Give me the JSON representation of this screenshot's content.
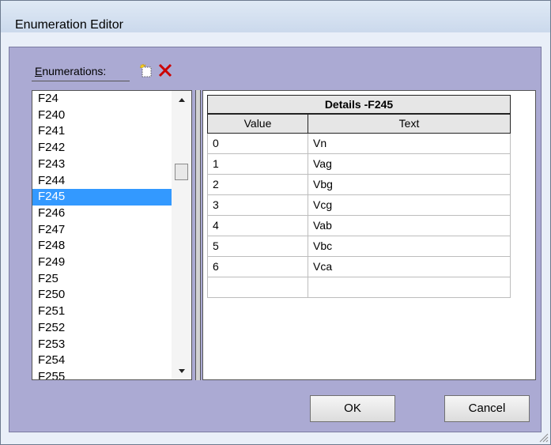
{
  "window": {
    "title": "Enumeration Editor"
  },
  "toolbar": {
    "enumerations_label_mnemonic": "E",
    "enumerations_label_rest": "numerations:",
    "new_icon": "new-document-icon",
    "delete_icon": "red-x-icon"
  },
  "enum_list": {
    "items": [
      "F24",
      "F240",
      "F241",
      "F242",
      "F243",
      "F244",
      "F245",
      "F246",
      "F247",
      "F248",
      "F249",
      "F25",
      "F250",
      "F251",
      "F252",
      "F253",
      "F254",
      "F255"
    ],
    "selected": "F245"
  },
  "details": {
    "title": "Details -F245",
    "columns": [
      "Value",
      "Text"
    ],
    "rows": [
      {
        "value": "0",
        "text": "Vn"
      },
      {
        "value": "1",
        "text": "Vag"
      },
      {
        "value": "2",
        "text": "Vbg"
      },
      {
        "value": "3",
        "text": "Vcg"
      },
      {
        "value": "4",
        "text": "Vab"
      },
      {
        "value": "5",
        "text": "Vbc"
      },
      {
        "value": "6",
        "text": "Vca"
      },
      {
        "value": "",
        "text": ""
      }
    ]
  },
  "buttons": {
    "ok": "OK",
    "cancel": "Cancel"
  },
  "colors": {
    "client_bg": "#abaad3",
    "selection": "#3399ff",
    "delete_icon": "#cc0000"
  }
}
